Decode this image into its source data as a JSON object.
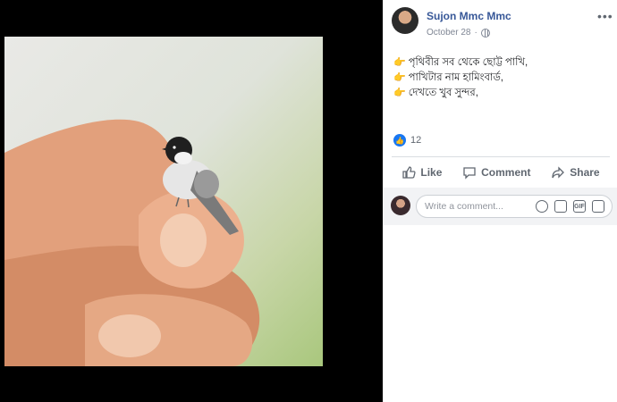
{
  "post": {
    "author": "Sujon Mmc Mmc",
    "date": "October 28",
    "more_label": "•••",
    "lines": [
      {
        "emoji": "👉",
        "text": "পৃথিবীর সব থেকে ছোট্ট পাখি,"
      },
      {
        "emoji": "👉",
        "text": "পাখিটার নাম হামিংবার্ড,"
      },
      {
        "emoji": "👉",
        "text": "দেখতে খুব সুন্দর,"
      }
    ],
    "reaction_count": "12"
  },
  "actions": {
    "like": "Like",
    "comment": "Comment",
    "share": "Share"
  },
  "comment": {
    "placeholder": "Write a comment...",
    "value": ""
  },
  "colors": {
    "author_link": "#385898",
    "like_blue": "#1877f2"
  }
}
